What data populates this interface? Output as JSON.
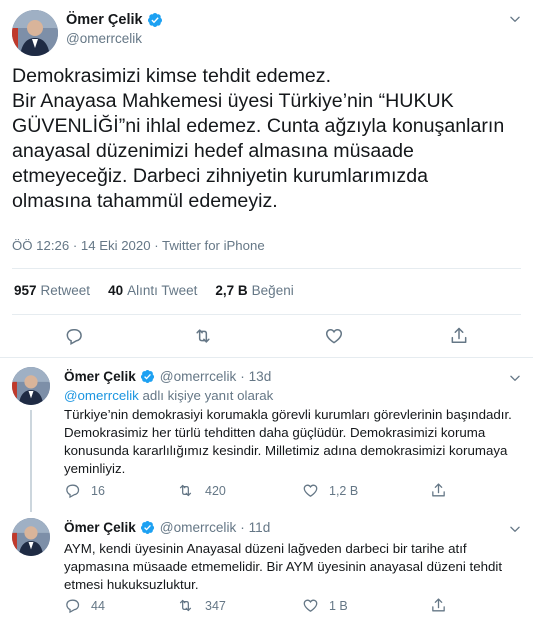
{
  "main_tweet": {
    "author_name": "Ömer Çelik",
    "author_handle": "@omerrcelik",
    "text_lines": [
      "Demokrasimizi kimse tehdit edemez.",
      "Bir Anayasa Mahkemesi üyesi Türkiye’nin “HUKUK",
      "GÜVENLİĞİ”ni ihlal edemez. Cunta ağzıyla konuşanların",
      "anayasal düzenimizi hedef almasına müsaade",
      "etmeyeceğiz. Darbeci zihniyetin kurumlarımızda",
      "olmasına tahammül edemeyiz."
    ],
    "meta": "ÖÖ 12:26 · 14 Eki 2020 · Twitter for iPhone",
    "stats": {
      "retweets_count": "957",
      "retweets_label": "Retweet",
      "quotes_count": "40",
      "quotes_label": "Alıntı Tweet",
      "likes_count": "2,7 B",
      "likes_label": "Beğeni"
    }
  },
  "replies": [
    {
      "author_name": "Ömer Çelik",
      "author_handle": "@omerrcelik",
      "time": "· 13d",
      "reply_to_handle": "@omerrcelik",
      "reply_to_suffix": " adlı kişiye yanıt olarak",
      "text_lines": [
        "Türkiye’nin demokrasiyi korumakla görevli kurumları görevlerinin başındadır.",
        "Demokrasimiz her türlü tehditten daha güçlüdür. Demokrasimizi koruma",
        "konusunda kararlılığımız kesindir. Milletimiz adına demokrasimizi korumaya",
        "yeminliyiz."
      ],
      "replies_count": "16",
      "retweets_count": "420",
      "likes_count": "1,2 B"
    },
    {
      "author_name": "Ömer Çelik",
      "author_handle": "@omerrcelik",
      "time": "· 11d",
      "text_lines": [
        "AYM, kendi üyesinin Anayasal düzeni lağveden darbeci bir tarihe atıf",
        "yapmasına müsaade etmemelidir. Bir AYM üyesinin anayasal düzeni tehdit",
        "etmesi hukuksuzluktur."
      ],
      "replies_count": "44",
      "retweets_count": "347",
      "likes_count": "1 B"
    }
  ],
  "colors": {
    "verified": "#1da1f2",
    "link": "#1b95e0",
    "muted": "#657786",
    "divider": "#e6ecf0"
  },
  "icons": [
    "verified-badge-icon",
    "chevron-down-icon",
    "reply-icon",
    "retweet-icon",
    "like-icon",
    "share-icon"
  ]
}
